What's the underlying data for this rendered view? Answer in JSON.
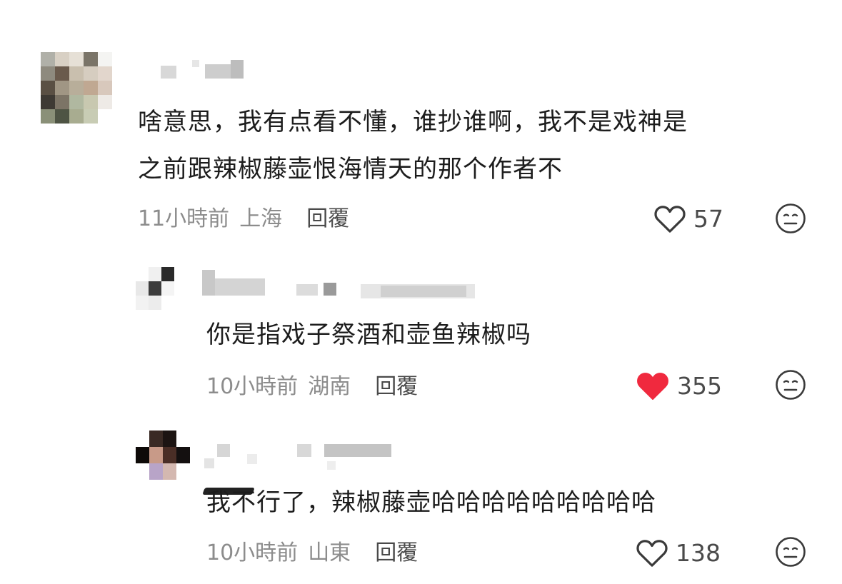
{
  "comments": [
    {
      "text_lines": [
        "啥意思，我有点看不懂，谁抄谁啊，我不是戏神是",
        "之前跟辣椒藤壶恨海情天的那个作者不"
      ],
      "time": "11小時前",
      "location": "上海",
      "reply_label": "回覆",
      "likes": "57",
      "liked": false,
      "like_icon": "heart-outline-icon",
      "dislike_icon": "meh-face-icon"
    },
    {
      "text_lines": [
        "你是指戏子祭酒和壶鱼辣椒吗"
      ],
      "time": "10小時前",
      "location": "湖南",
      "reply_label": "回覆",
      "likes": "355",
      "liked": true,
      "like_icon": "heart-filled-icon",
      "dislike_icon": "meh-face-icon"
    },
    {
      "text_lines": [
        "我不行了，辣椒藤壶哈哈哈哈哈哈哈哈哈"
      ],
      "time": "10小時前",
      "location": "山東",
      "reply_label": "回覆",
      "likes": "138",
      "liked": false,
      "like_icon": "heart-outline-icon",
      "dislike_icon": "meh-face-icon"
    }
  ],
  "colors": {
    "liked": "#f0293e",
    "meta": "#8c8c8c",
    "text": "#1c1c1c"
  }
}
